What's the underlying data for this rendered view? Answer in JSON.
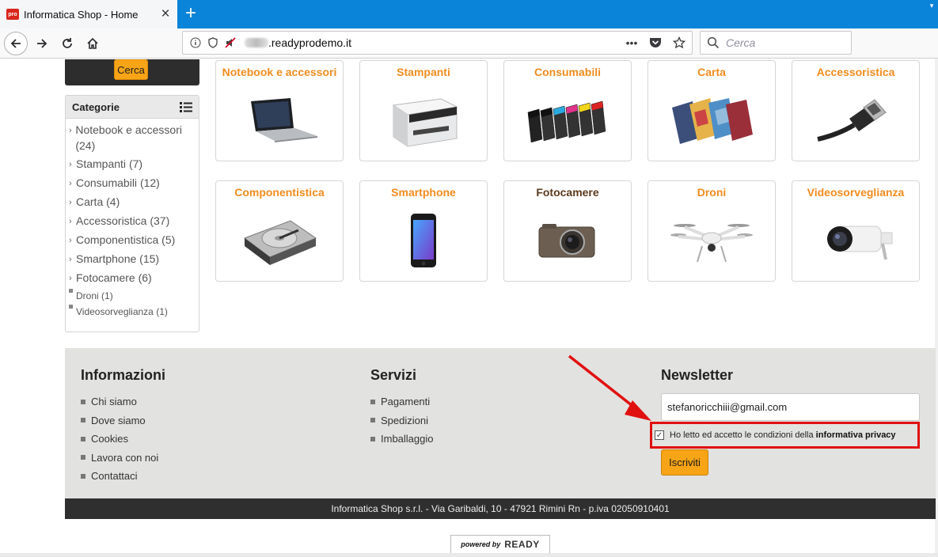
{
  "browser": {
    "tab_title": "Informatica Shop - Home",
    "favicon_text": "pro",
    "url": ".readyprodemo.it",
    "search_placeholder": "Cerca",
    "icons": [
      "back-icon",
      "forward-icon",
      "reload-icon",
      "home-icon",
      "info-icon",
      "tracking-shield-icon",
      "blocked-autoplay-icon",
      "page-actions-icon",
      "pocket-icon",
      "bookmark-star-icon",
      "search-icon",
      "close-icon",
      "new-tab-icon"
    ]
  },
  "sidebar": {
    "search_button": "Cerca",
    "categories_title": "Categorie",
    "categories": [
      {
        "label": "Notebook e accessori",
        "count": "(24)"
      },
      {
        "label": "Stampanti",
        "count": "(7)"
      },
      {
        "label": "Consumabili",
        "count": "(12)"
      },
      {
        "label": "Carta",
        "count": "(4)"
      },
      {
        "label": "Accessoristica",
        "count": "(37)"
      },
      {
        "label": "Componentistica",
        "count": "(5)"
      },
      {
        "label": "Smartphone",
        "count": "(15)"
      },
      {
        "label": "Fotocamere",
        "count": "(6)"
      },
      {
        "label": "Droni",
        "count": "(1)"
      },
      {
        "label": "Videosorveglianza",
        "count": "(1)"
      }
    ]
  },
  "products": [
    {
      "label": "Notebook e accessori",
      "icon": "laptop-image"
    },
    {
      "label": "Stampanti",
      "icon": "printer-image"
    },
    {
      "label": "Consumabili",
      "icon": "ink-cartridges-image"
    },
    {
      "label": "Carta",
      "icon": "photo-paper-image"
    },
    {
      "label": "Accessoristica",
      "icon": "hdmi-cable-image"
    },
    {
      "label": "Componentistica",
      "icon": "hard-disk-image"
    },
    {
      "label": "Smartphone",
      "icon": "smartphone-image"
    },
    {
      "label": "Fotocamere",
      "icon": "camera-image"
    },
    {
      "label": "Droni",
      "icon": "drone-image"
    },
    {
      "label": "Videosorveglianza",
      "icon": "security-camera-image"
    }
  ],
  "footer": {
    "info_title": "Informazioni",
    "info_links": [
      "Chi siamo",
      "Dove siamo",
      "Cookies",
      "Lavora con noi",
      "Contattaci"
    ],
    "services_title": "Servizi",
    "services_links": [
      "Pagamenti",
      "Spedizioni",
      "Imballaggio"
    ],
    "newsletter_title": "Newsletter",
    "newsletter_email": "stefanoricchiii@gmail.com",
    "privacy_text": "Ho letto ed accetto le condizioni della ",
    "privacy_link": "informativa privacy",
    "privacy_checked": true,
    "subscribe_button": "Iscriviti",
    "company_line": "Informatica Shop s.r.l. - Via Garibaldi, 10 - 47921 Rimini Rn - p.iva 02050910401",
    "powered_by": "powered by",
    "powered_brand": "READY"
  },
  "colors": {
    "accent_orange": "#f7a416",
    "category_label": "#f28c1e",
    "annotation_red": "#e11010",
    "firefox_blue": "#0a84d8"
  }
}
